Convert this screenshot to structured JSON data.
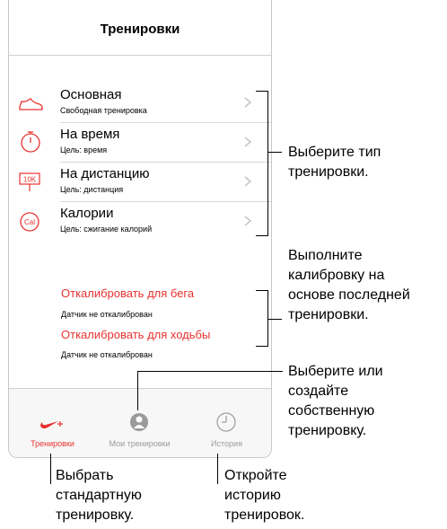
{
  "nav": {
    "title": "Тренировки"
  },
  "workouts": [
    {
      "icon": "shoe-icon",
      "title": "Основная",
      "subtitle": "Свободная тренировка"
    },
    {
      "icon": "stopwatch-icon",
      "title": "На время",
      "subtitle": "Цель: время"
    },
    {
      "icon": "distance-10k-icon",
      "title": "На дистанцию",
      "subtitle": "Цель: дистанция"
    },
    {
      "icon": "calories-icon",
      "title": "Калории",
      "subtitle": "Цель: сжигание калорий"
    }
  ],
  "calibration": [
    {
      "title": "Откалибровать для бега",
      "subtitle": "Датчик не откалиброван"
    },
    {
      "title": "Откалибровать для ходьбы",
      "subtitle": "Датчик не откалиброван"
    }
  ],
  "calibration_icon_text": {
    "distance": "10K",
    "calories": "Cal"
  },
  "tabs": [
    {
      "label": "Тренировки",
      "icon": "nike-plus-icon",
      "active": true
    },
    {
      "label": "Мои тренировки",
      "icon": "my-workouts-icon",
      "active": false
    },
    {
      "label": "История",
      "icon": "history-clock-icon",
      "active": false
    }
  ],
  "annotations": {
    "choose_type": [
      "Выберите тип",
      "тренировки."
    ],
    "calibrate": [
      "Выполните",
      "калибровку на",
      "основе последней",
      "тренировки."
    ],
    "choose_create": [
      "Выберите или",
      "создайте",
      "собственную",
      "тренировку."
    ],
    "standard": [
      "Выбрать",
      "стандартную",
      "тренировку."
    ],
    "history": [
      "Откройте",
      "историю",
      "тренировок."
    ]
  },
  "colors": {
    "accent": "#e8322f",
    "inactive": "#9a9a9a"
  }
}
